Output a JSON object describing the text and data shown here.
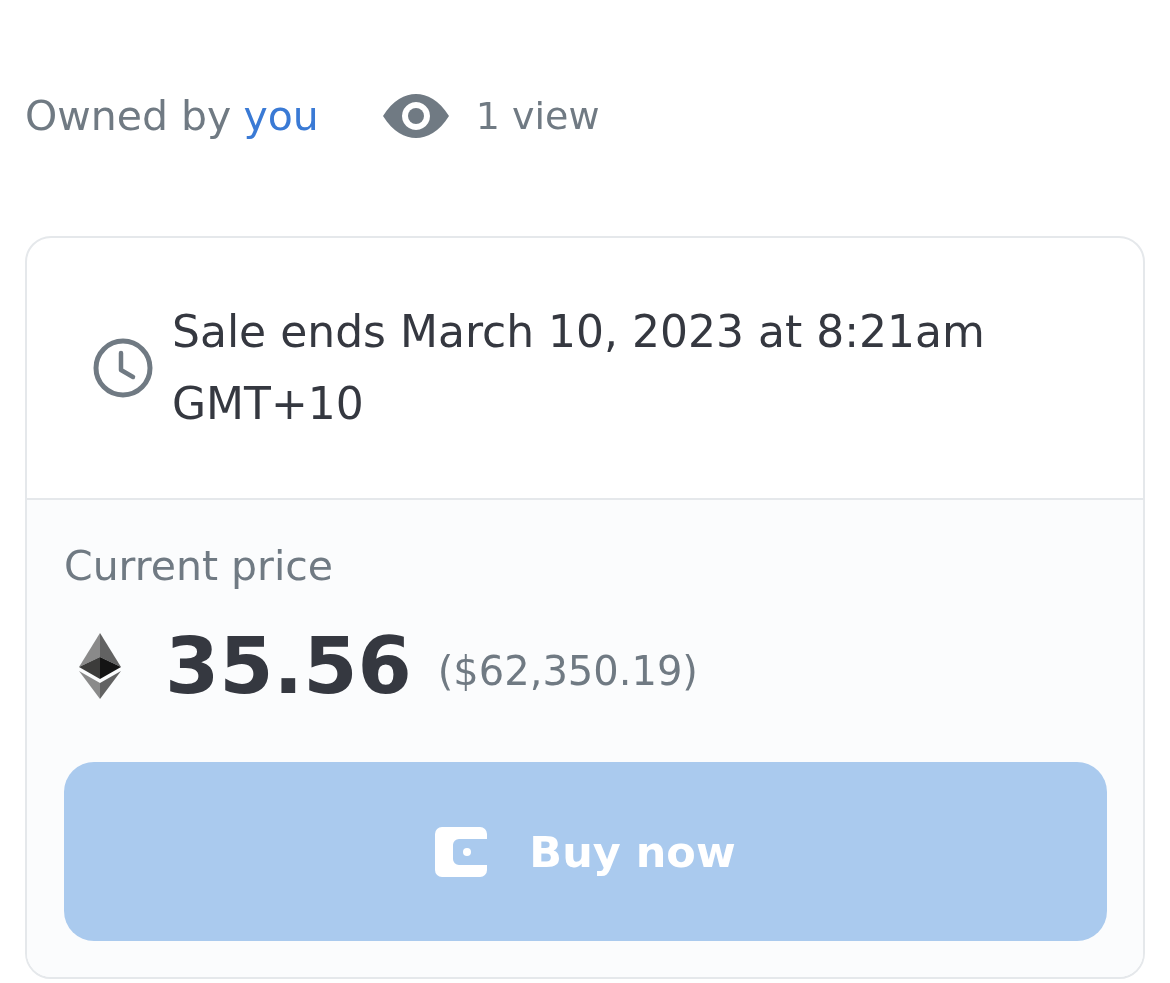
{
  "owner": {
    "label": "Owned by",
    "name": "you"
  },
  "views": {
    "text": "1 view"
  },
  "listing": {
    "sale_end": "Sale ends March 10, 2023 at 8:21am GMT+10",
    "price_label": "Current price",
    "price": "35.56",
    "price_fiat": "($62,350.19)",
    "buy_button": {
      "label": "Buy now",
      "disabled": true
    }
  }
}
